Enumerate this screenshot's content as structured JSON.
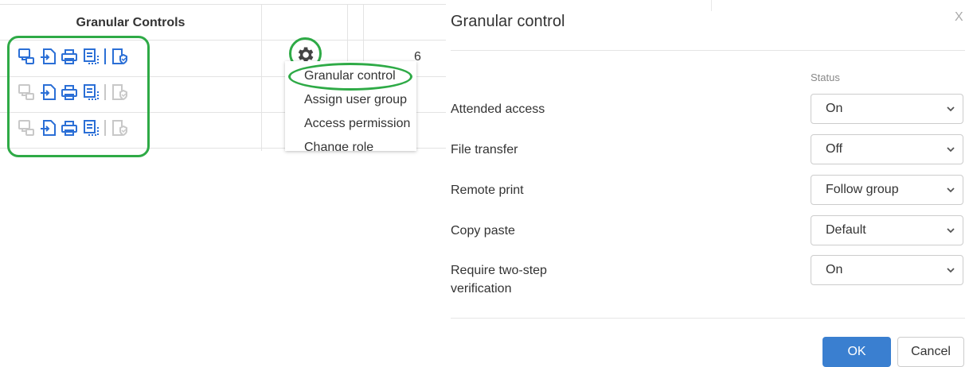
{
  "table": {
    "header": "Granular Controls",
    "number_cell": "6",
    "rows": [
      {
        "icons": [
          "remote-access-icon",
          "file-transfer-icon",
          "remote-print-icon",
          "copy-paste-icon",
          "two-step-verification-icon"
        ],
        "state": "enabled-first"
      },
      {
        "icons": [
          "remote-access-icon",
          "file-transfer-icon",
          "remote-print-icon",
          "copy-paste-icon",
          "two-step-verification-icon"
        ],
        "state": "mixed"
      },
      {
        "icons": [
          "remote-access-icon",
          "file-transfer-icon",
          "remote-print-icon",
          "copy-paste-icon",
          "two-step-verification-icon"
        ],
        "state": "mixed"
      }
    ]
  },
  "context_menu": {
    "items": [
      "Granular control",
      "Assign user group",
      "Access permission",
      "Change role"
    ]
  },
  "dialog": {
    "title": "Granular control",
    "close": "X",
    "status_header": "Status",
    "rows": [
      {
        "label": "Attended access",
        "value": "On"
      },
      {
        "label": "File transfer",
        "value": "Off"
      },
      {
        "label": "Remote print",
        "value": "Follow group"
      },
      {
        "label": "Copy paste",
        "value": "Default"
      },
      {
        "label": "Require two-step verification",
        "value": "On"
      }
    ],
    "ok_label": "OK",
    "cancel_label": "Cancel"
  },
  "colors": {
    "icon_enabled": "#2b6fd6",
    "icon_disabled": "#c8c8c8",
    "highlight": "#2eaa46",
    "primary_button": "#3a7fd0"
  }
}
